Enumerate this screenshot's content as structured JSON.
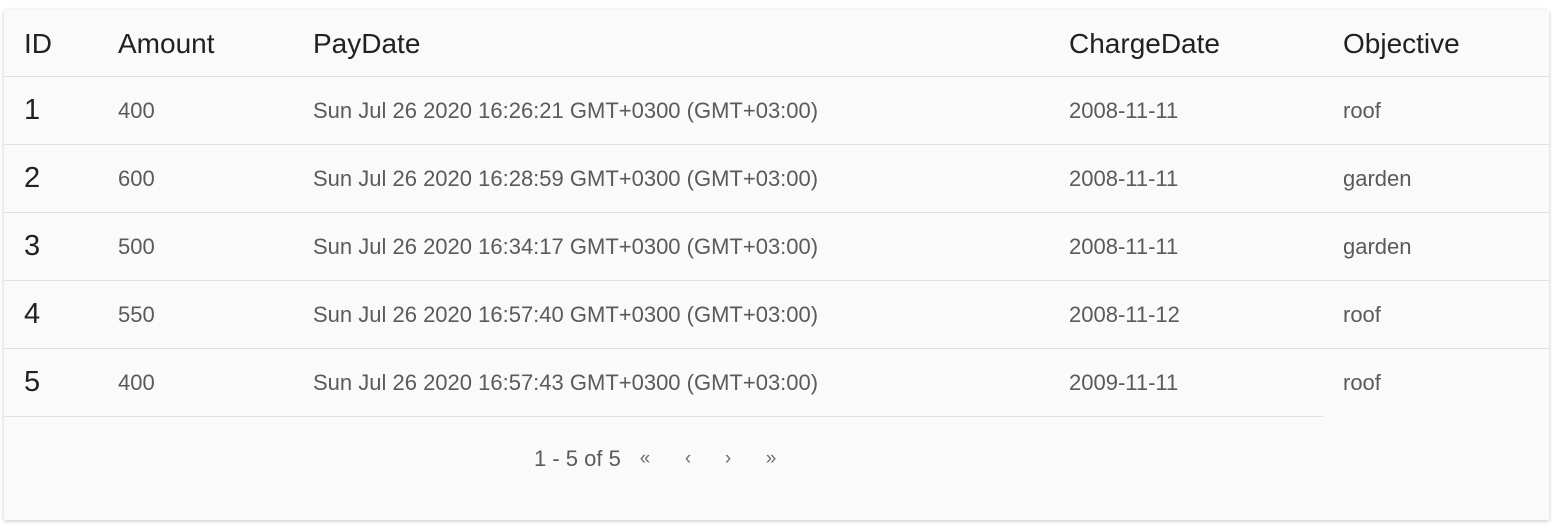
{
  "table": {
    "headers": {
      "id": "ID",
      "amount": "Amount",
      "paydate": "PayDate",
      "chargedate": "ChargeDate",
      "objective": "Objective"
    },
    "rows": [
      {
        "id": "1",
        "amount": "400",
        "paydate": "Sun Jul 26 2020 16:26:21 GMT+0300 (GMT+03:00)",
        "chargedate": "2008-11-11",
        "objective": "roof"
      },
      {
        "id": "2",
        "amount": "600",
        "paydate": "Sun Jul 26 2020 16:28:59 GMT+0300 (GMT+03:00)",
        "chargedate": "2008-11-11",
        "objective": "garden"
      },
      {
        "id": "3",
        "amount": "500",
        "paydate": "Sun Jul 26 2020 16:34:17 GMT+0300 (GMT+03:00)",
        "chargedate": "2008-11-11",
        "objective": "garden"
      },
      {
        "id": "4",
        "amount": "550",
        "paydate": "Sun Jul 26 2020 16:57:40 GMT+0300 (GMT+03:00)",
        "chargedate": "2008-11-12",
        "objective": "roof"
      },
      {
        "id": "5",
        "amount": "400",
        "paydate": "Sun Jul 26 2020 16:57:43 GMT+0300 (GMT+03:00)",
        "chargedate": "2009-11-11",
        "objective": "roof"
      }
    ]
  },
  "pager": {
    "info": "1 - 5 of 5",
    "first": "«",
    "prev": "‹",
    "next": "›",
    "last": "»",
    "icons": {
      "first": "first-page-icon",
      "prev": "previous-page-icon",
      "next": "next-page-icon",
      "last": "last-page-icon"
    }
  }
}
